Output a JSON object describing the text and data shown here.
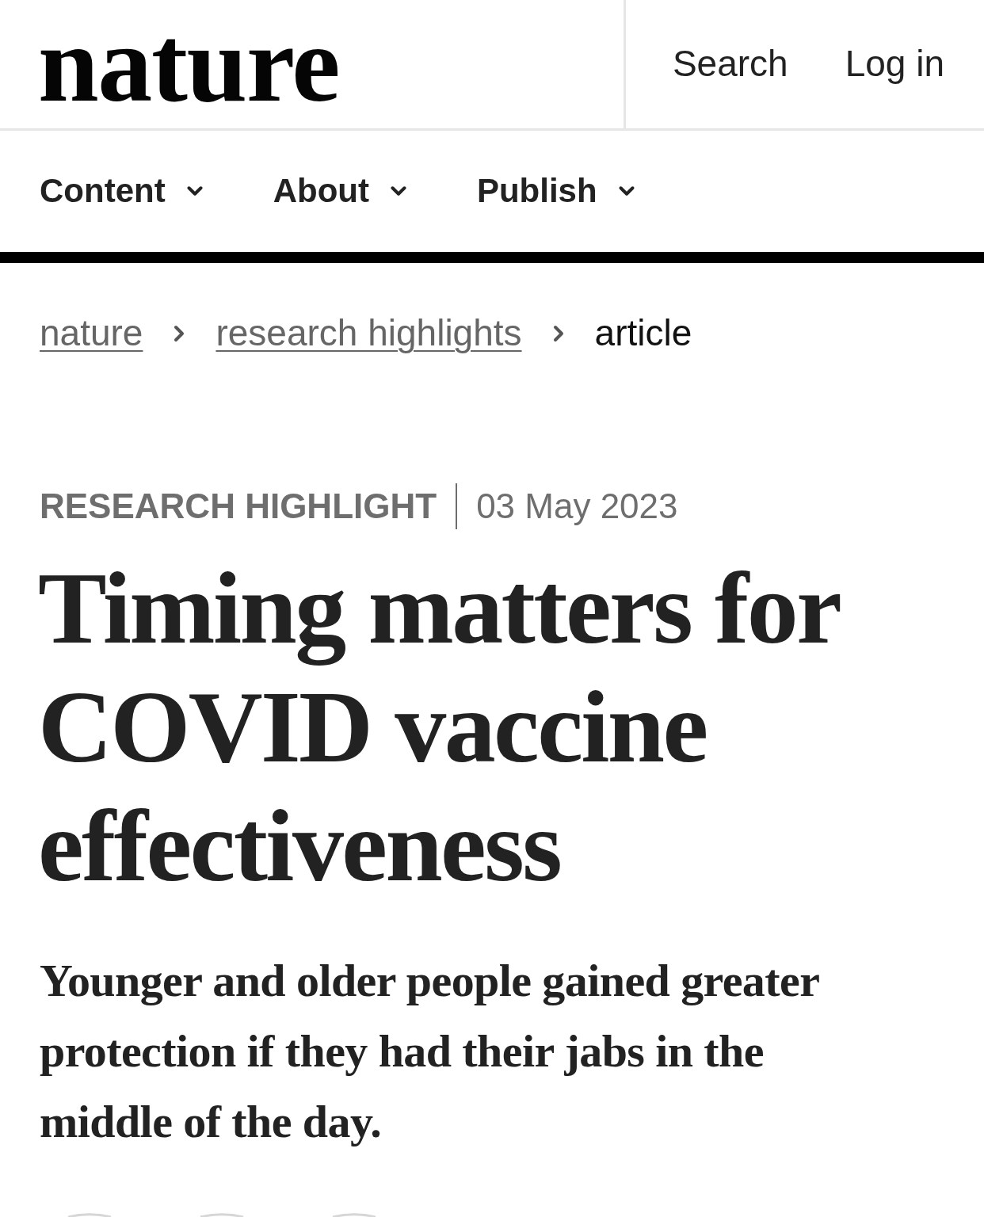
{
  "header": {
    "logo": "nature",
    "actions": [
      {
        "label": "Search"
      },
      {
        "label": "Log in"
      }
    ]
  },
  "nav": {
    "items": [
      {
        "label": "Content",
        "expanded": false
      },
      {
        "label": "About",
        "expanded": false
      },
      {
        "label": "Publish",
        "expanded": false
      }
    ]
  },
  "breadcrumbs": [
    {
      "label": "nature",
      "kind": "link"
    },
    {
      "label": "research highlights",
      "kind": "link"
    },
    {
      "label": "article",
      "kind": "current"
    }
  ],
  "article": {
    "type": "RESEARCH HIGHLIGHT",
    "date": "03 May 2023",
    "title": "Timing matters for COVID vaccine effectiveness",
    "standfirst": "Younger and older people gained greater protection if they had their jabs in the middle of the day."
  }
}
